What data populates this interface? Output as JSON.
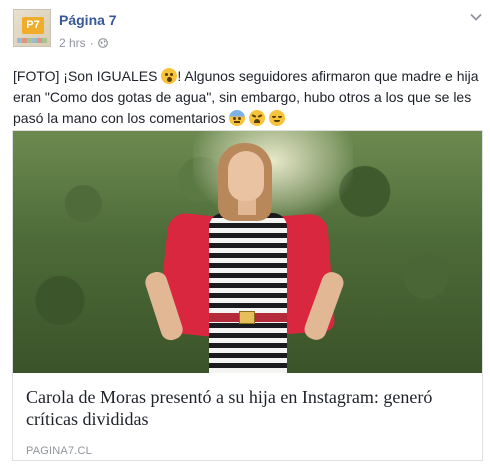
{
  "post": {
    "page_name": "Página 7",
    "timestamp": "2 hrs",
    "separator": "·",
    "privacy_icon": "globe-icon",
    "menu_icon": "chevron-down-icon",
    "text": {
      "part1": "[FOTO] ¡Son IGUALES ",
      "part2": "! Algunos seguidores afirmaron que madre e hija eran \"Como dos gotas de agua\", sin embargo, hubo otros a los que se les pasó la mano con los comentarios "
    },
    "emojis": [
      "astonished-emoji",
      "cold-sweat-emoji",
      "tired-face-emoji",
      "relieved-emoji"
    ]
  },
  "link_card": {
    "title": "Carola de Moras presentó a su hija en Instagram: generó críticas divididas",
    "domain": "PAGINA7.CL"
  },
  "colors": {
    "link_blue": "#365899",
    "meta_gray": "#90949c",
    "text": "#1d2129",
    "border": "#dddfe2"
  }
}
